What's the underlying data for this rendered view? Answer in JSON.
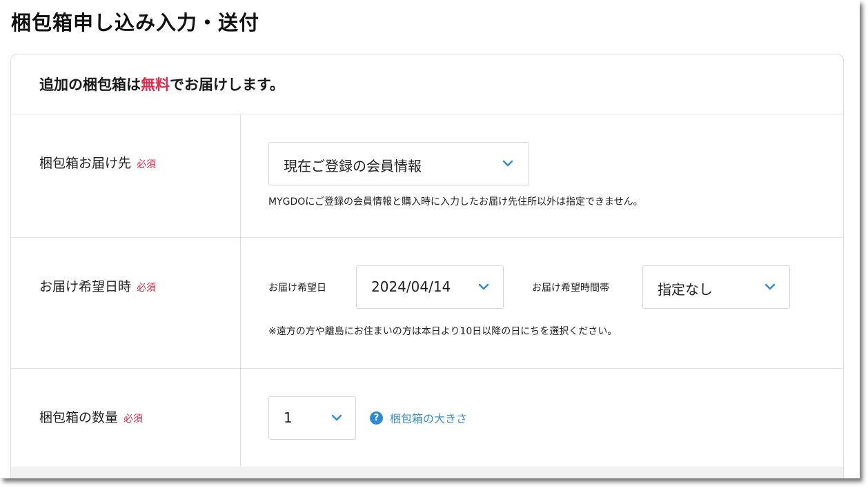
{
  "page": {
    "title": "梱包箱申し込み入力・送付"
  },
  "card": {
    "headline_pre": "追加の梱包箱は",
    "headline_free": "無料",
    "headline_post": "でお届けします。"
  },
  "delivery_address": {
    "label": "梱包箱お届け先",
    "required": "必須",
    "selected": "現在ご登録の会員情報",
    "note": "MYGDOにご登録の会員情報と購入時に入力したお届け先住所以外は指定できません。"
  },
  "delivery_datetime": {
    "label": "お届け希望日時",
    "required": "必須",
    "date_label": "お届け希望日",
    "date_value": "2024/04/14",
    "time_label": "お届け希望時間帯",
    "time_value": "指定なし",
    "note": "※遠方の方や離島にお住まいの方は本日より10日以降の日にちを選択ください。"
  },
  "quantity": {
    "label": "梱包箱の数量",
    "required": "必須",
    "value": "1",
    "help_link": "梱包箱の大きさ"
  },
  "colors": {
    "accent_red": "#e0294a",
    "link_blue": "#3a8fd1",
    "chevron_blue": "#2f8ad6"
  },
  "icons": {
    "dropdown": "chevron-down-icon",
    "help": "question-circle-icon"
  }
}
